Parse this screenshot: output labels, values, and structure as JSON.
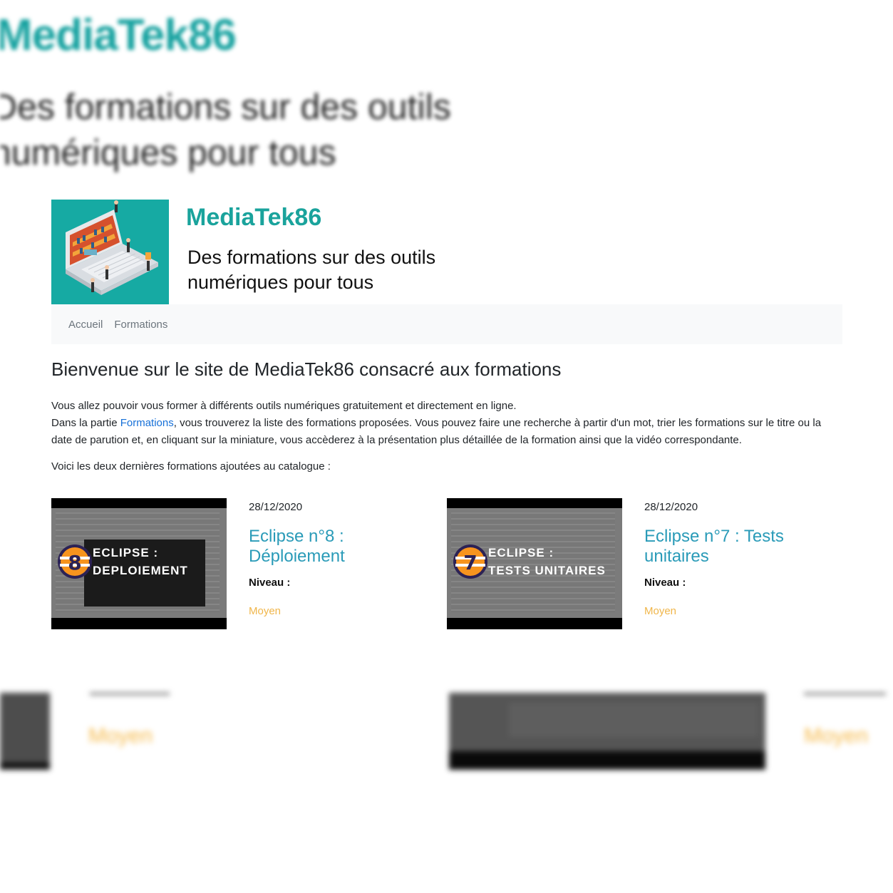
{
  "brand": "MediaTek86",
  "tagline_line1": "Des formations sur des outils",
  "tagline_line2": "numériques pour tous",
  "backdrop": {
    "brand": "MediaTek86",
    "tagline_line1": "Des formations sur des outils",
    "tagline_line2": "numériques pour tous",
    "level": "Moyen"
  },
  "nav": [
    {
      "label": "Accueil"
    },
    {
      "label": "Formations"
    }
  ],
  "main": {
    "title": "Bienvenue sur le site de MediaTek86 consacré aux formations",
    "intro_line1": "Vous allez pouvoir vous former à différents outils numériques gratuitement et directement en ligne.",
    "intro_pre": "Dans la partie ",
    "intro_link": "Formations",
    "intro_post": ", vous trouverez la liste des formations proposées. Vous pouvez faire une recherche à partir d'un mot, trier les formations sur le titre ou la date de parution et, en cliquant sur la miniature, vous accèderez à la présentation plus détaillée de la formation ainsi que la vidéo correspondante.",
    "catalogue_text": "Voici les deux dernières formations ajoutées au catalogue :"
  },
  "cards": [
    {
      "date": "28/12/2020",
      "title": "Eclipse n°8 : Déploiement",
      "level_label": "Niveau :",
      "level": "Moyen",
      "thumb_line1": "ECLIPSE :",
      "thumb_line2": "DEPLOIEMENT",
      "badge_number": "8"
    },
    {
      "date": "28/12/2020",
      "title": "Eclipse n°7 : Tests unitaires",
      "level_label": "Niveau :",
      "level": "Moyen",
      "thumb_line1": "ECLIPSE :",
      "thumb_line2": "TESTS UNITAIRES",
      "badge_number": "7"
    }
  ],
  "colors": {
    "brand": "#1aa39c",
    "card_title": "#2a9bb8",
    "level": "#f0b64a",
    "link": "#1670d8"
  }
}
